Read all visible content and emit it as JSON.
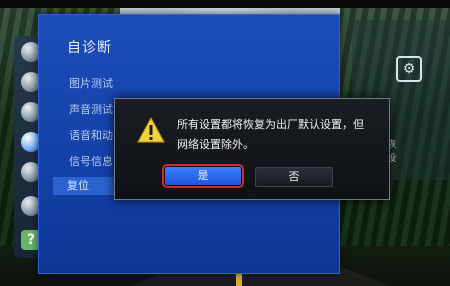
{
  "menu": {
    "title": "自诊断",
    "items": [
      {
        "label": "图片测试"
      },
      {
        "label": "声音测试"
      },
      {
        "label": "语音和动"
      },
      {
        "label": "信号信息"
      },
      {
        "label": "复位"
      }
    ],
    "selected_index": 4
  },
  "dialog": {
    "message_line1": "所有设置都将恢复为出厂默认设置，但",
    "message_line2": "网络设置除外。",
    "yes_label": "是",
    "no_label": "否",
    "focused_button": "yes"
  },
  "side_panel": {
    "text_line1": "复都将恢",
    "text_line2": "但网络设"
  },
  "colors": {
    "panel": "#1a47b0",
    "highlight_border": "#d62828",
    "yes_button": "#2c6af0"
  }
}
